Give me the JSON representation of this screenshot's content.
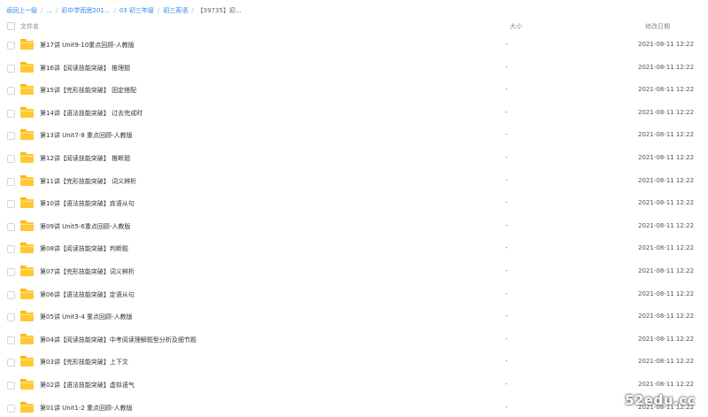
{
  "breadcrumb": [
    {
      "label": "返回上一级",
      "current": false
    },
    {
      "label": "...",
      "current": false
    },
    {
      "label": "初中学而思201...",
      "current": false
    },
    {
      "label": "03 初三年级",
      "current": false
    },
    {
      "label": "初三英语",
      "current": false
    },
    {
      "label": "【39735】初...",
      "current": true
    }
  ],
  "columns": {
    "name": "文件名",
    "size": "大小",
    "date": "修改日期"
  },
  "files": [
    {
      "name": "第17讲 Unit9-10重点回顾-人教版",
      "size": "-",
      "date": "2021-08-11 12:22"
    },
    {
      "name": "第16讲【阅读技能突破】 推理题",
      "size": "-",
      "date": "2021-08-11 12:22"
    },
    {
      "name": "第15讲【完形技能突破】 固定搭配",
      "size": "-",
      "date": "2021-08-11 12:22"
    },
    {
      "name": "第14讲【语法技能突破】 过去完成时",
      "size": "-",
      "date": "2021-08-11 12:22"
    },
    {
      "name": "第13讲 Unit7-8 重点回顾-人教版",
      "size": "-",
      "date": "2021-08-11 12:22"
    },
    {
      "name": "第12讲【阅读技能突破】 推断题",
      "size": "-",
      "date": "2021-08-11 12:22"
    },
    {
      "name": "第11讲【完形技能突破】 词义辨析",
      "size": "-",
      "date": "2021-08-11 12:22"
    },
    {
      "name": "第10讲【语法技能突破】宾语从句",
      "size": "-",
      "date": "2021-08-11 12:22"
    },
    {
      "name": "第09讲 Unit5-6重点回顾-人教版",
      "size": "-",
      "date": "2021-08-11 12:22"
    },
    {
      "name": "第08讲【阅读技能突破】判断题",
      "size": "-",
      "date": "2021-08-11 12:22"
    },
    {
      "name": "第07讲【完形技能突破】词义辨析",
      "size": "-",
      "date": "2021-08-11 12:22"
    },
    {
      "name": "第06讲【语法技能突破】定语从句",
      "size": "-",
      "date": "2021-08-11 12:22"
    },
    {
      "name": "第05讲 Unit3-4 重点回顾-人教版",
      "size": "-",
      "date": "2021-08-11 12:22"
    },
    {
      "name": "第04讲【阅读技能突破】中考阅读理解题型分析及细节题",
      "size": "-",
      "date": "2021-08-11 12:22"
    },
    {
      "name": "第03讲【完形技能突破】上下文",
      "size": "-",
      "date": "2021-08-11 12:22"
    },
    {
      "name": "第02讲【语法技能突破】虚拟语气",
      "size": "-",
      "date": "2021-08-11 12:22"
    },
    {
      "name": "第01讲 Unit1-2 重点回顾-人教版",
      "size": "-",
      "date": "2021-08-11 12:22"
    }
  ],
  "watermark": "52edu.cc",
  "colors": {
    "link": "#2f87e8",
    "folder": "#ffc933"
  }
}
